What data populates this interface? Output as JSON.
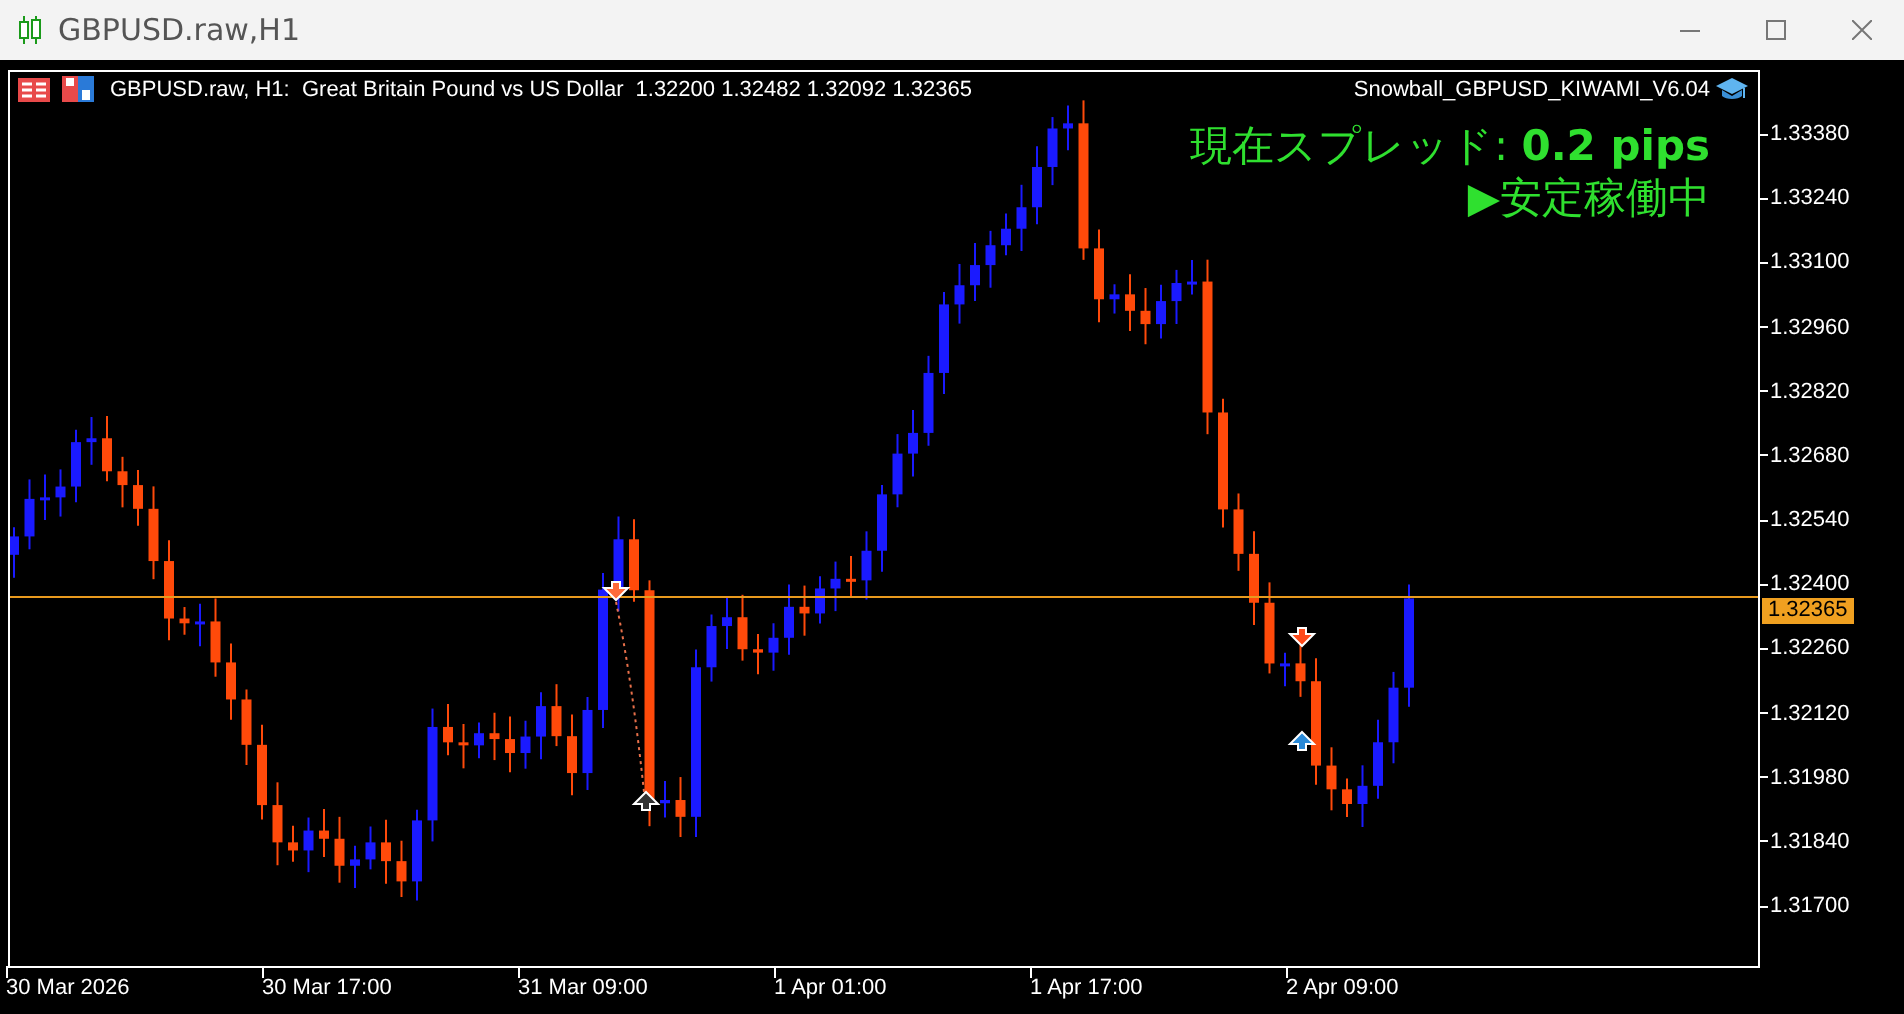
{
  "window": {
    "title": "GBPUSD.raw,H1"
  },
  "chart_header": {
    "symbol": "GBPUSD.raw, H1:  Great Britain Pound vs US Dollar",
    "ohlc": "1.32200 1.32482 1.32092 1.32365",
    "expert": "Snowball_GBPUSD_KIWAMI_V6.04"
  },
  "overlay": {
    "spread": "現在スプレッド: **0.2 pips**",
    "status": "▶安定稼働中"
  },
  "price_axis": {
    "ticks": [
      "1.33380",
      "1.33240",
      "1.33100",
      "1.32960",
      "1.32820",
      "1.32680",
      "1.32540",
      "1.32400",
      "1.32260",
      "1.32120",
      "1.31980",
      "1.31840",
      "1.31700"
    ],
    "current_price": "1.32365"
  },
  "time_axis": {
    "labels": [
      "30 Mar 2026",
      "30 Mar 17:00",
      "31 Mar 09:00",
      "1 Apr 01:00",
      "1 Apr 17:00",
      "2 Apr 09:00"
    ]
  }
}
